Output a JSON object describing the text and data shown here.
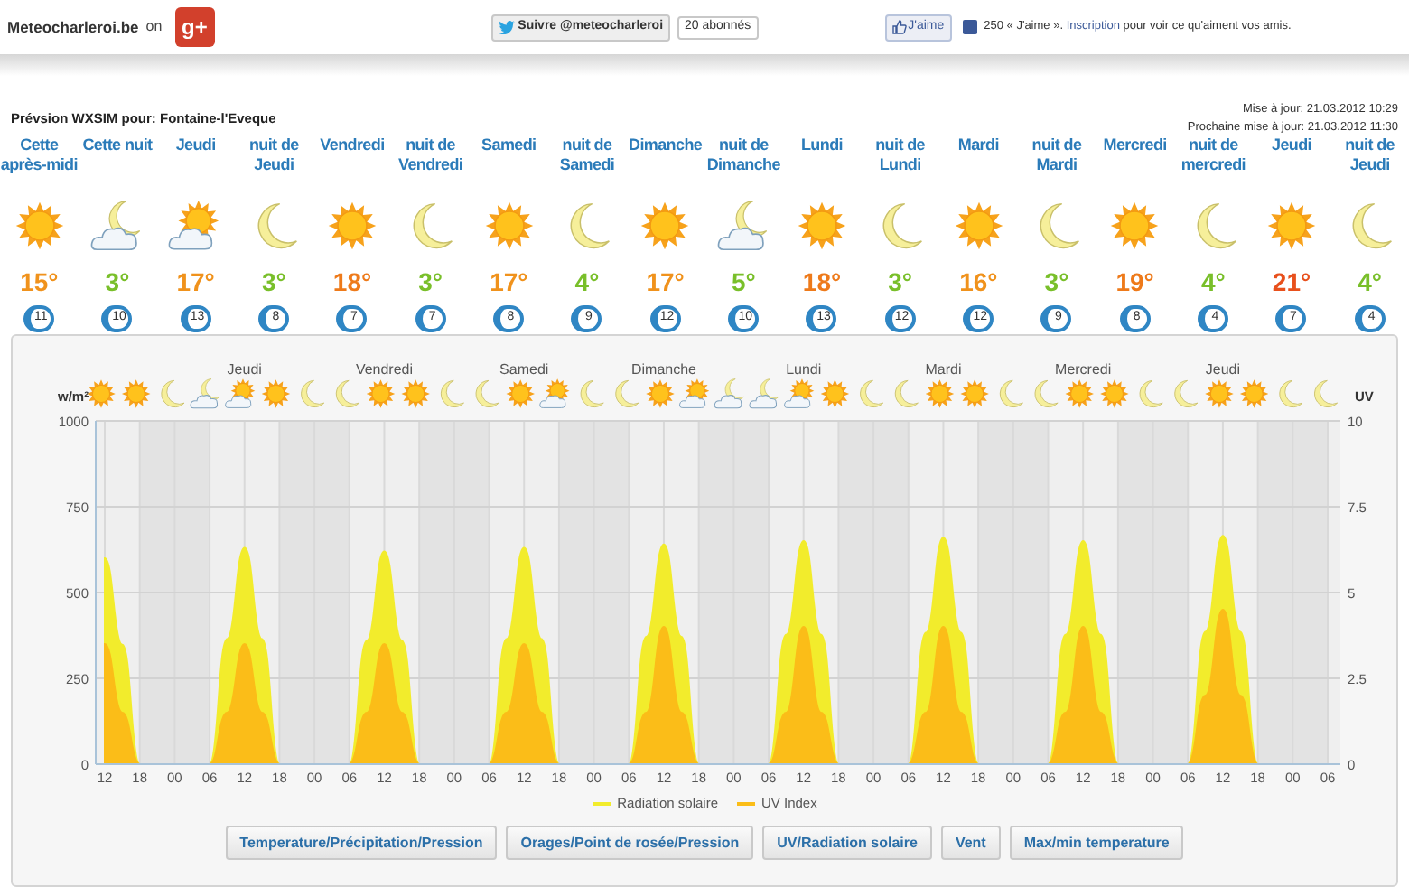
{
  "top_bar": {
    "site": "Meteocharleroi.be",
    "on": "on",
    "gplus_logo": "g+",
    "twitter_button": "Suivre @meteocharleroi",
    "twitter_count": "20 abonnés",
    "like_button": "J'aime",
    "like_text_before": "250 « J'aime ». ",
    "like_link": "Inscription",
    "like_text_after": " pour voir ce qu'aiment vos amis."
  },
  "title": "Prévsion WXSIM pour: Fontaine-l'Eveque",
  "updated": "Mise à jour: 21.03.2012 10:29",
  "next_update": "Prochaine mise à jour: 21.03.2012 11:30",
  "forecast": [
    {
      "label": "Cette après-midi",
      "kind": "sun",
      "temp": "15°",
      "color": "#f0921c",
      "uv": "11"
    },
    {
      "label": "Cette nuit",
      "kind": "cloud-moon",
      "temp": "3°",
      "color": "#79bf2a",
      "uv": "10"
    },
    {
      "label": "Jeudi",
      "kind": "sun-cloud",
      "temp": "17°",
      "color": "#f0921c",
      "uv": "13"
    },
    {
      "label": "nuit de Jeudi",
      "kind": "moon",
      "temp": "3°",
      "color": "#79bf2a",
      "uv": "8"
    },
    {
      "label": "Vendredi",
      "kind": "sun",
      "temp": "18°",
      "color": "#ee7a1a",
      "uv": "7"
    },
    {
      "label": "nuit de Vendredi",
      "kind": "moon",
      "temp": "3°",
      "color": "#79bf2a",
      "uv": "7"
    },
    {
      "label": "Samedi",
      "kind": "sun",
      "temp": "17°",
      "color": "#f0921c",
      "uv": "8"
    },
    {
      "label": "nuit de Samedi",
      "kind": "moon",
      "temp": "4°",
      "color": "#79bf2a",
      "uv": "9"
    },
    {
      "label": "Dimanche",
      "kind": "sun",
      "temp": "17°",
      "color": "#f0921c",
      "uv": "12"
    },
    {
      "label": "nuit de Dimanche",
      "kind": "cloud-moon",
      "temp": "5°",
      "color": "#79bf2a",
      "uv": "10"
    },
    {
      "label": "Lundi",
      "kind": "sun",
      "temp": "18°",
      "color": "#ee7a1a",
      "uv": "13"
    },
    {
      "label": "nuit de Lundi",
      "kind": "moon",
      "temp": "3°",
      "color": "#79bf2a",
      "uv": "12"
    },
    {
      "label": "Mardi",
      "kind": "sun",
      "temp": "16°",
      "color": "#f0921c",
      "uv": "12"
    },
    {
      "label": "nuit de Mardi",
      "kind": "moon",
      "temp": "3°",
      "color": "#79bf2a",
      "uv": "9"
    },
    {
      "label": "Mercredi",
      "kind": "sun",
      "temp": "19°",
      "color": "#ee7a1a",
      "uv": "8"
    },
    {
      "label": "nuit de mercredi",
      "kind": "moon",
      "temp": "4°",
      "color": "#79bf2a",
      "uv": "4"
    },
    {
      "label": "Jeudi",
      "kind": "sun",
      "temp": "21°",
      "color": "#e8501c",
      "uv": "7"
    },
    {
      "label": "nuit de Jeudi",
      "kind": "moon",
      "temp": "4°",
      "color": "#79bf2a",
      "uv": "4"
    }
  ],
  "chart_days": [
    "Jeudi",
    "Vendredi",
    "Samedi",
    "Dimanche",
    "Lundi",
    "Mardi",
    "Mercredi",
    "Jeudi"
  ],
  "icon_strip": [
    {
      "kind": "sun"
    },
    {
      "kind": "sun"
    },
    {
      "kind": "moon"
    },
    {
      "kind": "cloud-moon"
    },
    {
      "kind": "sun-cloud"
    },
    {
      "kind": "sun"
    },
    {
      "kind": "moon"
    },
    {
      "kind": "moon"
    },
    {
      "kind": "sun"
    },
    {
      "kind": "sun"
    },
    {
      "kind": "moon"
    },
    {
      "kind": "moon"
    },
    {
      "kind": "sun"
    },
    {
      "kind": "sun-cloud"
    },
    {
      "kind": "moon"
    },
    {
      "kind": "moon"
    },
    {
      "kind": "sun"
    },
    {
      "kind": "sun-cloud"
    },
    {
      "kind": "cloud-moon"
    },
    {
      "kind": "cloud-moon"
    },
    {
      "kind": "sun-cloud"
    },
    {
      "kind": "sun"
    },
    {
      "kind": "moon"
    },
    {
      "kind": "moon"
    },
    {
      "kind": "sun"
    },
    {
      "kind": "sun"
    },
    {
      "kind": "moon"
    },
    {
      "kind": "moon"
    },
    {
      "kind": "sun"
    },
    {
      "kind": "sun"
    },
    {
      "kind": "moon"
    },
    {
      "kind": "moon"
    },
    {
      "kind": "sun"
    },
    {
      "kind": "sun"
    },
    {
      "kind": "moon"
    },
    {
      "kind": "moon"
    }
  ],
  "chart_data": {
    "type": "area",
    "grid": true,
    "ylabel": "w/m²",
    "y2label": "UV",
    "ylim": [
      0,
      1000
    ],
    "yticks": [
      0,
      250,
      500,
      750,
      1000
    ],
    "y2lim": [
      0,
      10
    ],
    "y2ticks": [
      0,
      2.5,
      5,
      7.5,
      10
    ],
    "categories": [
      "12",
      null,
      "18",
      null,
      "00",
      null,
      "06",
      null,
      "12",
      null,
      "18",
      null,
      "00",
      null,
      "06",
      null,
      "12",
      null,
      "18",
      null,
      "00",
      null,
      "06",
      null,
      "12",
      null,
      "18",
      null,
      "00",
      null,
      "06",
      null,
      "12",
      null,
      "18",
      null,
      "00",
      null,
      "06",
      null,
      "12",
      null,
      "18",
      null,
      "00",
      null,
      "06",
      null,
      "12",
      null,
      "18",
      null,
      "00",
      null,
      "06",
      null,
      "12",
      null,
      "18",
      null,
      "00",
      null,
      "06",
      null,
      "12",
      null,
      "18",
      null,
      "00",
      null,
      "06"
    ],
    "series": [
      {
        "name": "Radiation solaire",
        "color": "#f2ec2c",
        "values": [
          600,
          348,
          0,
          0,
          0,
          0,
          0,
          365,
          630,
          365,
          0,
          0,
          0,
          0,
          0,
          360,
          620,
          360,
          0,
          0,
          0,
          0,
          0,
          365,
          630,
          365,
          0,
          0,
          0,
          0,
          0,
          371,
          640,
          371,
          0,
          0,
          0,
          0,
          0,
          377,
          650,
          377,
          0,
          0,
          0,
          0,
          0,
          383,
          660,
          383,
          0,
          0,
          0,
          0,
          0,
          377,
          650,
          377,
          0,
          0,
          0,
          0,
          0,
          386,
          665,
          386,
          0,
          0,
          0,
          0,
          0
        ]
      },
      {
        "name": "UV Index",
        "color": "#fbbd18",
        "axis": "y2",
        "values": [
          3.5,
          1.5,
          0,
          0,
          0,
          0,
          0,
          1.5,
          3.5,
          1.5,
          0,
          0,
          0,
          0,
          0,
          1.5,
          3.5,
          1.5,
          0,
          0,
          0,
          0,
          0,
          1.5,
          3.5,
          1.5,
          0,
          0,
          0,
          0,
          0,
          1.5,
          4,
          1.5,
          0,
          0,
          0,
          0,
          0,
          1.5,
          4,
          1.5,
          0,
          0,
          0,
          0,
          0,
          1.5,
          4,
          1.5,
          0,
          0,
          0,
          0,
          0,
          1.5,
          4,
          1.5,
          0,
          0,
          0,
          0,
          0,
          2,
          4.5,
          2,
          0,
          0,
          0,
          0,
          0
        ]
      }
    ]
  },
  "buttons": [
    "Temperature/Précipitation/Pression",
    "Orages/Point de rosée/Pression",
    "UV/Radiation solaire",
    "Vent",
    "Max/min temperature"
  ]
}
